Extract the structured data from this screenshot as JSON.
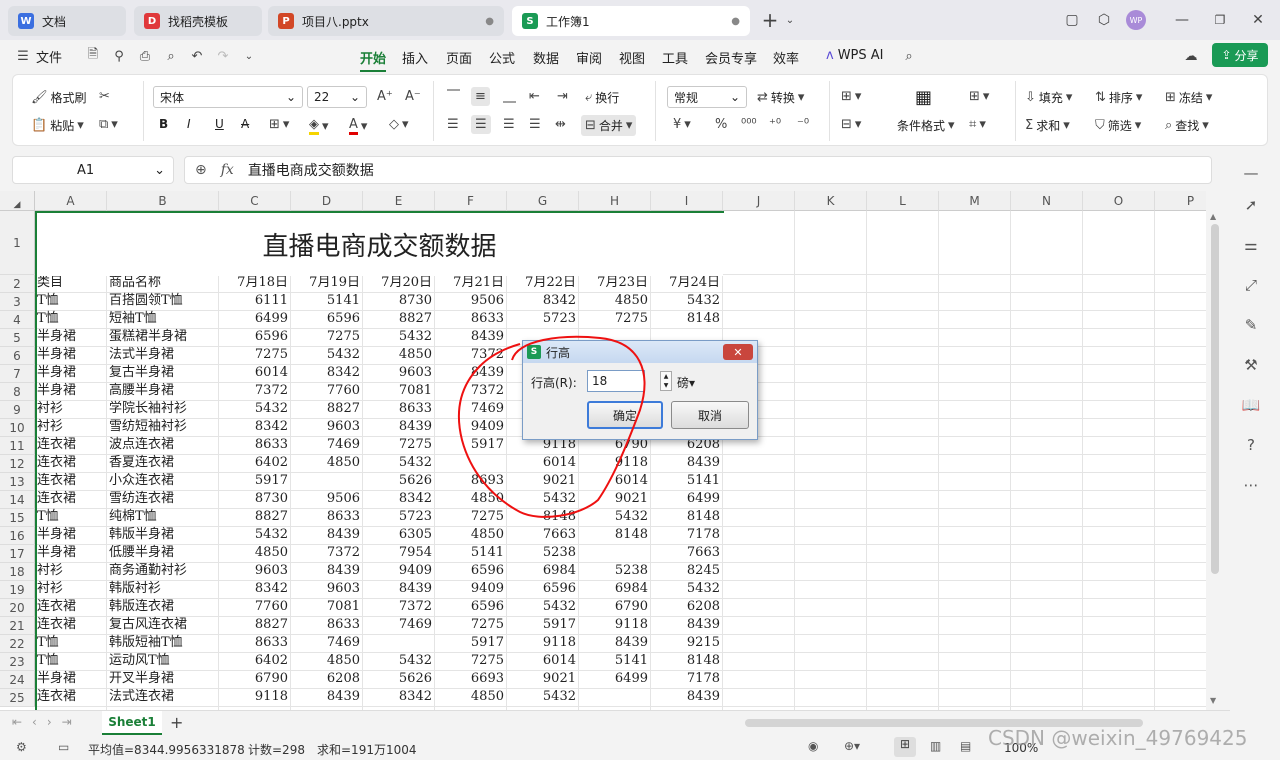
{
  "tabs": [
    {
      "label": "文档",
      "icon": "W",
      "color": "#3b6fe0",
      "close": ""
    },
    {
      "label": "找稻壳模板",
      "icon": "D",
      "color": "#e0383b",
      "close": ""
    },
    {
      "label": "项目八.pptx",
      "icon": "P",
      "color": "#d24726",
      "close": "●"
    },
    {
      "label": "工作簿1",
      "icon": "S",
      "color": "#1a9a55",
      "close": "●"
    }
  ],
  "menu": {
    "file": "文件",
    "items": [
      "开始",
      "插入",
      "页面",
      "公式",
      "数据",
      "审阅",
      "视图",
      "工具",
      "会员专享",
      "效率"
    ],
    "wps_ai": "WPS AI",
    "share": "分享"
  },
  "ribbon": {
    "format_painter": "格式刷",
    "paste": "粘贴",
    "font_name": "宋体",
    "font_size": "22",
    "wrap": "换行",
    "merge": "合并",
    "num_format": "常规",
    "convert": "转换",
    "cond_format": "条件格式",
    "fill": "填充",
    "sort": "排序",
    "freeze": "冻结",
    "sum": "求和",
    "filter": "筛选",
    "find": "查找"
  },
  "formula_bar": {
    "cell_ref": "A1",
    "fx": "fx",
    "content": "直播电商成交额数据"
  },
  "columns": [
    "A",
    "B",
    "C",
    "D",
    "E",
    "F",
    "G",
    "H",
    "I",
    "J",
    "K",
    "L",
    "M",
    "N",
    "O",
    "P"
  ],
  "sheet": {
    "title": "直播电商成交额数据",
    "headers": [
      "类目",
      "商品名称",
      "7月18日",
      "7月19日",
      "7月20日",
      "7月21日",
      "7月22日",
      "7月23日",
      "7月24日"
    ],
    "rows": [
      [
        "T恤",
        "百搭圆领T恤",
        "6111",
        "5141",
        "8730",
        "9506",
        "8342",
        "4850",
        "5432"
      ],
      [
        "T恤",
        "短袖T恤",
        "6499",
        "6596",
        "8827",
        "8633",
        "5723",
        "7275",
        "8148"
      ],
      [
        "半身裙",
        "蛋糕裙半身裙",
        "6596",
        "7275",
        "5432",
        "8439",
        "",
        "",
        ""
      ],
      [
        "半身裙",
        "法式半身裙",
        "7275",
        "5432",
        "4850",
        "7372",
        "",
        "",
        ""
      ],
      [
        "半身裙",
        "复古半身裙",
        "6014",
        "8342",
        "9603",
        "8439",
        "",
        "",
        ""
      ],
      [
        "半身裙",
        "高腰半身裙",
        "7372",
        "7760",
        "7081",
        "7372",
        "",
        "",
        ""
      ],
      [
        "衬衫",
        "学院长袖衬衫",
        "5432",
        "8827",
        "8633",
        "7469",
        "",
        "",
        ""
      ],
      [
        "衬衫",
        "雪纺短袖衬衫",
        "8342",
        "9603",
        "8439",
        "9409",
        "",
        "",
        ""
      ],
      [
        "连衣裙",
        "波点连衣裙",
        "8633",
        "7469",
        "7275",
        "5917",
        "9118",
        "6790",
        "6208"
      ],
      [
        "连衣裙",
        "香夏连衣裙",
        "6402",
        "4850",
        "5432",
        "",
        "6014",
        "9118",
        "8439"
      ],
      [
        "连衣裙",
        "小众连衣裙",
        "5917",
        "",
        "5626",
        "8693",
        "9021",
        "6014",
        "5141"
      ],
      [
        "连衣裙",
        "雪纺连衣裙",
        "8730",
        "9506",
        "8342",
        "4850",
        "5432",
        "9021",
        "6499"
      ],
      [
        "T恤",
        "纯棉T恤",
        "8827",
        "8633",
        "5723",
        "7275",
        "8148",
        "5432",
        "8148"
      ],
      [
        "半身裙",
        "韩版半身裙",
        "5432",
        "8439",
        "6305",
        "4850",
        "7663",
        "8148",
        "7178"
      ],
      [
        "半身裙",
        "低腰半身裙",
        "4850",
        "7372",
        "7954",
        "5141",
        "5238",
        "",
        "7663"
      ],
      [
        "衬衫",
        "商务通勤衬衫",
        "9603",
        "8439",
        "9409",
        "6596",
        "6984",
        "5238",
        "8245"
      ],
      [
        "衬衫",
        "韩版衬衫",
        "8342",
        "9603",
        "8439",
        "9409",
        "6596",
        "6984",
        "5432"
      ],
      [
        "连衣裙",
        "韩版连衣裙",
        "7760",
        "7081",
        "7372",
        "6596",
        "5432",
        "6790",
        "6208"
      ],
      [
        "连衣裙",
        "复古风连衣裙",
        "8827",
        "8633",
        "7469",
        "7275",
        "5917",
        "9118",
        "8439"
      ],
      [
        "T恤",
        "韩版短袖T恤",
        "8633",
        "7469",
        "",
        "5917",
        "9118",
        "8439",
        "9215"
      ],
      [
        "T恤",
        "运动风T恤",
        "6402",
        "4850",
        "5432",
        "7275",
        "6014",
        "5141",
        "8148"
      ],
      [
        "半身裙",
        "开叉半身裙",
        "6790",
        "6208",
        "5626",
        "6693",
        "9021",
        "6499",
        "7178"
      ],
      [
        "连衣裙",
        "法式连衣裙",
        "9118",
        "8439",
        "8342",
        "4850",
        "5432",
        "",
        "8439"
      ]
    ]
  },
  "dialog": {
    "title": "行高",
    "label": "行高(R):",
    "value": "18",
    "unit": "磅▾",
    "ok": "确定",
    "cancel": "取消"
  },
  "sheet_tab": "Sheet1",
  "status": {
    "average": "平均值=8344.9956331878",
    "count": "计数=298",
    "sum": "求和=191万1004",
    "zoom": "100%"
  },
  "watermark": "CSDN @weixin_49769425"
}
